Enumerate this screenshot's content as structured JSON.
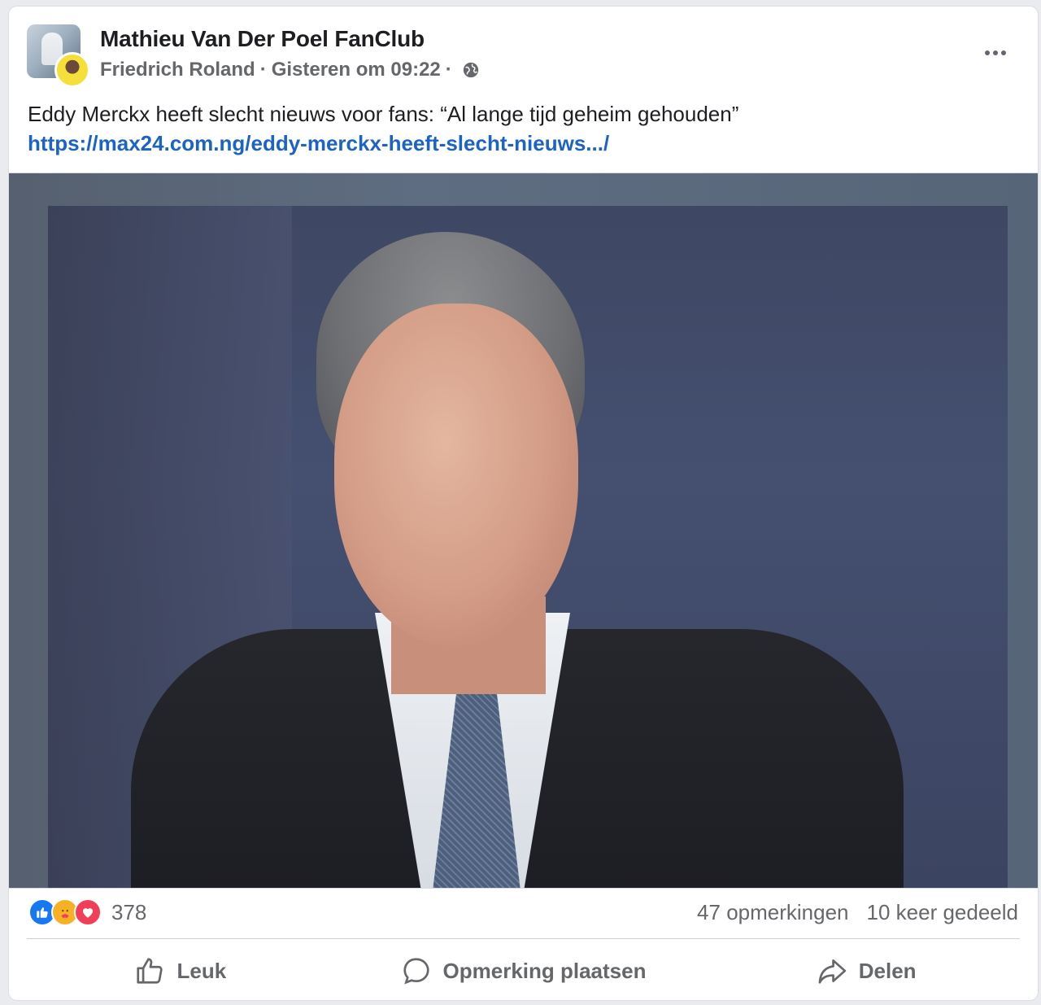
{
  "post": {
    "group_name": "Mathieu Van Der Poel FanClub",
    "author": "Friedrich Roland",
    "timestamp": "Gisteren om 09:22",
    "separator": "·",
    "audience_icon": "globe-icon",
    "text": "Eddy Merckx heeft slecht nieuws voor fans: “Al lange tijd geheim gehouden”",
    "link": "https://max24.com.ng/eddy-merckx-heeft-slecht-nieuws.../",
    "image_icon": "photo-of-man-in-suit"
  },
  "stats": {
    "reactions": [
      "like-icon",
      "care-icon",
      "love-icon"
    ],
    "reaction_count": "378",
    "comments": "47 opmerkingen",
    "shares": "10 keer gedeeld"
  },
  "actions": {
    "like": "Leuk",
    "comment": "Opmerking plaatsen",
    "share": "Delen"
  },
  "colors": {
    "link": "#1b64c4",
    "secondary_text": "#65676b",
    "like": "#1877f2",
    "love": "#f33e58",
    "care": "#f7b125"
  }
}
